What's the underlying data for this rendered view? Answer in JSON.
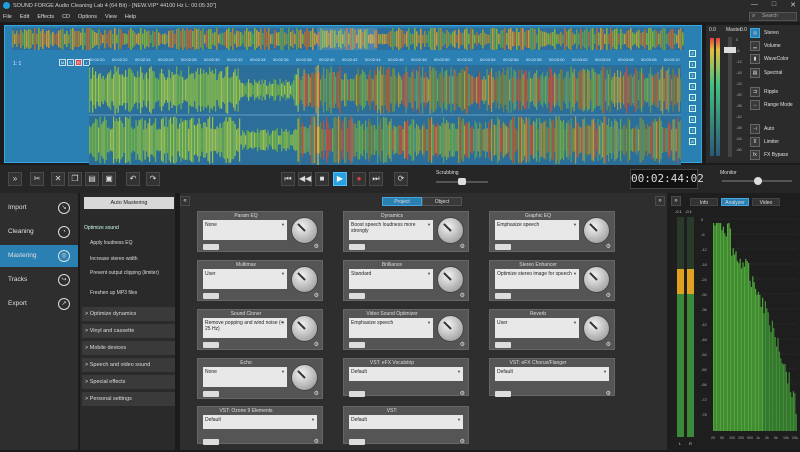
{
  "window": {
    "title": "SOUND FORGE Audio Cleaning Lab 4 (64 Bit) - [NEW.VIP*    44100 Hz L: 00:05:30\"]",
    "controls": [
      "—",
      "□",
      "✕"
    ]
  },
  "menu": {
    "items": [
      "File",
      "Edit",
      "Effects",
      "CD",
      "Options",
      "View",
      "Help"
    ],
    "search_placeholder": "Search"
  },
  "track": {
    "label": "1: 1",
    "buttons": [
      "M",
      "S",
      "R",
      "•"
    ]
  },
  "ruler": [
    "00:02:20",
    "00:02:22",
    "00:02:24",
    "00:02:26",
    "00:02:28",
    "00:02:30",
    "00:02:32",
    "00:02:34",
    "00:02:36",
    "00:02:38",
    "00:02:40",
    "00:02:42",
    "00:02:44",
    "00:02:46",
    "00:02:48",
    "00:02:50",
    "00:02:52",
    "00:02:54",
    "00:02:56",
    "00:02:58",
    "00:03:00",
    "00:03:02",
    "00:03:04",
    "00:03:06",
    "00:03:08",
    "00:03:10"
  ],
  "side_scale": [
    "Z",
    "1",
    "2",
    "3",
    "4",
    "5",
    "6",
    "7",
    "8"
  ],
  "master": {
    "label": "Master",
    "vol_left": "0.0",
    "vol_right": "0.0",
    "scale": [
      "0",
      "-6",
      "-12",
      "-18",
      "-24",
      "-30",
      "-36",
      "-42",
      "-48",
      "-54",
      "-60"
    ],
    "options": [
      "Stereo",
      "Volume",
      "WaveColor",
      "Spectral",
      "Ripple",
      "Range Mode",
      "Auto",
      "Limiter",
      "FX Bypass"
    ]
  },
  "transport": {
    "scrubbing_label": "Scrubbing",
    "time": "00:02:44:02",
    "monitor_label": "Monitor"
  },
  "nav": {
    "items": [
      "Import",
      "Cleaning",
      "Mastering",
      "Tracks",
      "Export"
    ]
  },
  "mastering": {
    "auto_button": "Auto Mastering",
    "group_title": "Optimize sound",
    "presets": [
      "Apply loudness EQ",
      "Increase stereo width",
      "Prevent output clipping (limiter)",
      "Freshen up MP3 files"
    ],
    "sections": [
      "> Optimize dynamics",
      "> Vinyl and cassette",
      "> Mobile devices",
      "> Speech and video sound",
      "> Special effects",
      "> Personal settings"
    ]
  },
  "tabs": {
    "project": "Project",
    "object": "Object"
  },
  "effects": [
    {
      "name": "Param EQ",
      "value": "None"
    },
    {
      "name": "Dynamics",
      "value": "Boost speech loudness more strongly"
    },
    {
      "name": "Graphic EQ",
      "value": "Emphasize speech"
    },
    {
      "name": "Multimax",
      "value": "User"
    },
    {
      "name": "Brilliance",
      "value": "Standard"
    },
    {
      "name": "Stereo Enhancer",
      "value": "Optimize stereo image for speech"
    },
    {
      "name": "Sound Cloner",
      "value": "Remove popping and wind noise (< 25 Hz)"
    },
    {
      "name": "Video Sound Optimizer",
      "value": "Emphasize speech"
    },
    {
      "name": "Reverb",
      "value": "User"
    },
    {
      "name": "Echo",
      "value": "None"
    },
    {
      "name": "VST: eFX Vocalstrip",
      "value": "Default"
    },
    {
      "name": "VST: eFX Chorus/Flanger",
      "value": "Default"
    },
    {
      "name": "VST: Ozone 9 Elements",
      "value": "Default"
    },
    {
      "name": "VST:",
      "value": "Default"
    }
  ],
  "analyzer": {
    "tabs": [
      "Info",
      "Analyzer",
      "Video"
    ],
    "x_labels": [
      "20",
      "50",
      "100",
      "200",
      "500",
      "1k",
      "2k",
      "5k",
      "10k",
      "20k"
    ],
    "y_labels": [
      "0",
      "-6",
      "-12",
      "-18",
      "-24",
      "-30",
      "-36",
      "-42",
      "-48",
      "-54",
      "-60",
      "-66",
      "-72",
      "-78"
    ],
    "meter_labels": [
      "L",
      "R"
    ],
    "meter_top": [
      "-0.1",
      "-0.1"
    ]
  }
}
